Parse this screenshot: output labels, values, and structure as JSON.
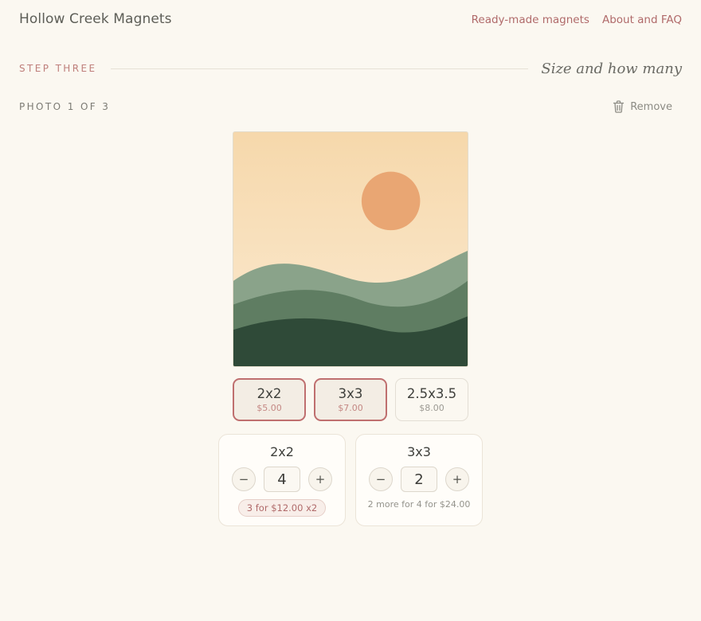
{
  "header": {
    "brand": "Hollow Creek Magnets",
    "nav": [
      "Ready-made magnets",
      "About and FAQ"
    ]
  },
  "step": {
    "label": "STEP THREE",
    "title": "Size and how many"
  },
  "photo": {
    "counter": "PHOTO 1 OF 3",
    "remove_label": "Remove"
  },
  "sizes": [
    {
      "name": "2x2",
      "price": "$5.00",
      "selected": true
    },
    {
      "name": "3x3",
      "price": "$7.00",
      "selected": true
    },
    {
      "name": "2.5x3.5",
      "price": "$8.00",
      "selected": false
    }
  ],
  "quantities": [
    {
      "size": "2x2",
      "qty": "4",
      "minus": "−",
      "plus": "+",
      "deal": "3 for $12.00 x2"
    },
    {
      "size": "3x3",
      "qty": "2",
      "minus": "−",
      "plus": "+",
      "deal": "2 more for 4 for $24.00"
    }
  ],
  "colors": {
    "background": "#fbf8f1",
    "accent": "#bf6f6f",
    "link": "#b06a6a",
    "sun": "#e9a673",
    "hill_light": "#8aa38a",
    "hill_mid": "#5f7d62",
    "hill_dark": "#2f4a38"
  },
  "icons": {
    "remove": "trash-icon"
  }
}
